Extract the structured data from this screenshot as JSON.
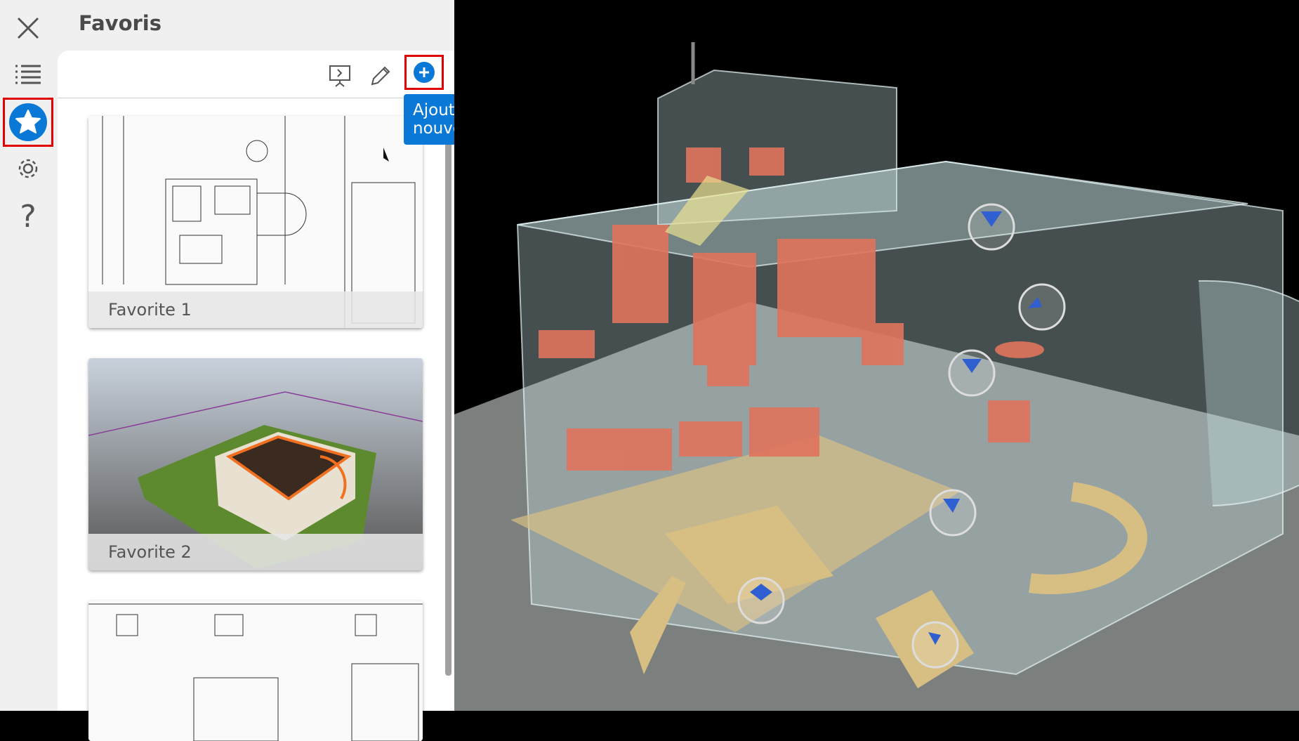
{
  "rail": {
    "items": [
      {
        "icon": "close-icon"
      },
      {
        "icon": "list-icon"
      },
      {
        "icon": "star-icon",
        "active": true
      },
      {
        "icon": "gear-icon"
      },
      {
        "icon": "help-icon"
      }
    ]
  },
  "panel": {
    "title": "Favoris",
    "toolbar": {
      "present_icon": "presentation-icon",
      "edit_icon": "pencil-icon",
      "add_icon": "plus-circle-icon"
    },
    "tooltip": "Ajouter nouveau",
    "favorites": [
      {
        "label": "Favorite 1"
      },
      {
        "label": "Favorite 2"
      },
      {
        "label": ""
      }
    ]
  },
  "colors": {
    "accent": "#0a78d6",
    "highlight": "#e00000"
  }
}
